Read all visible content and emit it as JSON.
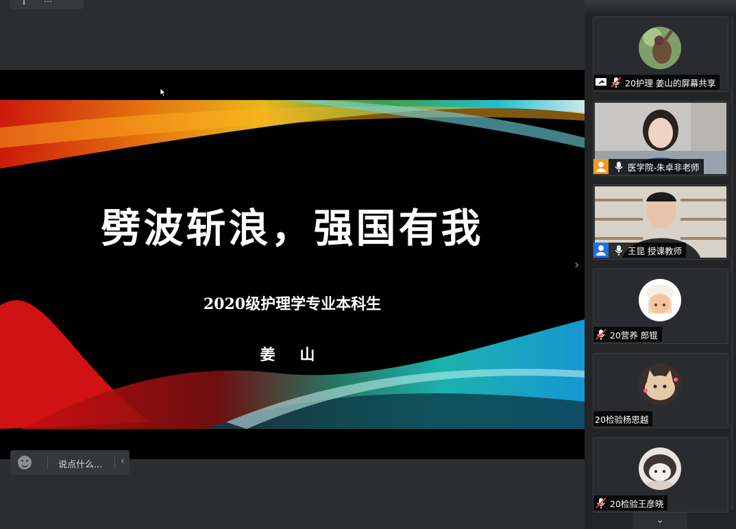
{
  "top_chip": {
    "text": "…"
  },
  "slide": {
    "title": "劈波斩浪，强国有我",
    "subtitle": "2020级护理学专业本科生",
    "author": "姜 山"
  },
  "chat": {
    "placeholder": "说点什么..."
  },
  "participants": [
    {
      "name": "20护理 姜山的屏幕共享",
      "type": "share",
      "mic": "muted",
      "avatar": "monkey"
    },
    {
      "name": "医学院-朱卓非老师",
      "type": "video",
      "mic": "on",
      "badge_color": "#f39a1b"
    },
    {
      "name": "王昆 授课教师",
      "type": "video",
      "mic": "on",
      "badge_color": "#1f6fe5"
    },
    {
      "name": "20营养 郎锟",
      "type": "avatar",
      "mic": "muted",
      "avatar": "cartoon-girl"
    },
    {
      "name": "20检验杨思越",
      "type": "avatar",
      "mic": "none",
      "avatar": "cat"
    },
    {
      "name": "20检验王彦晓",
      "type": "avatar",
      "mic": "muted",
      "avatar": "kuromi"
    }
  ]
}
